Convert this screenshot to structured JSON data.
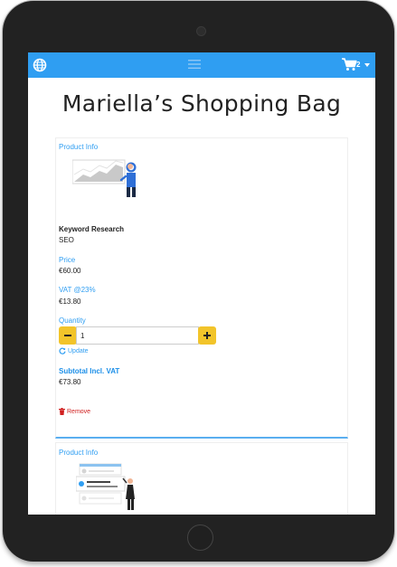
{
  "navbar": {
    "cart_count": "2",
    "background": "#2f9ef2"
  },
  "page": {
    "title": "Mariella’s Shopping Bag"
  },
  "items": [
    {
      "section_label": "Product Info",
      "name": "Keyword Research",
      "category": "SEO",
      "price_label": "Price",
      "price": "€60.00",
      "vat_label": "VAT @23%",
      "vat": "€13.80",
      "quantity_label": "Quantity",
      "quantity": "1",
      "update_label": "Update",
      "subtotal_label": "Subtotal Incl. VAT",
      "subtotal": "€73.80",
      "remove_label": "Remove"
    },
    {
      "section_label": "Product Info"
    }
  ],
  "colors": {
    "accent": "#2f9ef2",
    "button": "#f2c42a",
    "danger": "#d02020"
  },
  "icons": [
    "globe-icon",
    "menu-icon",
    "cart-icon",
    "refresh-icon",
    "trash-icon"
  ]
}
